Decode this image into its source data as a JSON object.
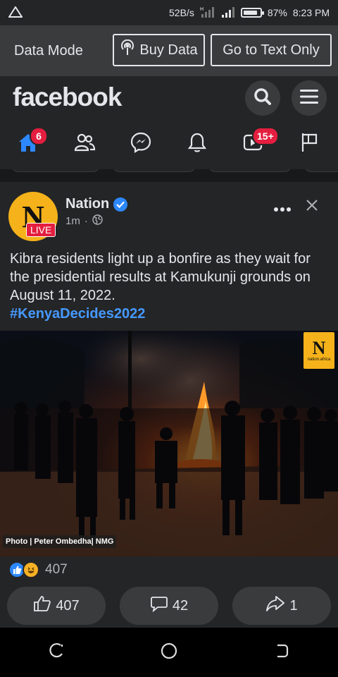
{
  "status_bar": {
    "network_speed": "52B/s",
    "battery_percent": "87%",
    "battery_level": 0.87,
    "time": "8:23 PM"
  },
  "data_mode": {
    "label": "Data Mode",
    "buy_data": "Buy Data",
    "text_only": "Go to Text Only"
  },
  "header": {
    "logo": "facebook"
  },
  "nav": {
    "home_badge": "6",
    "watch_badge": "15+"
  },
  "post": {
    "page_name": "Nation",
    "avatar_letter": "N",
    "live_label": "LIVE",
    "time_ago": "1m",
    "separator": "·",
    "text": "Kibra residents light up a bonfire as they wait for the presidential results at Kamukunji grounds on August 11, 2022.",
    "hashtag": "#KenyaDecides2022",
    "photo_credit": "Photo | Peter Ombedha| NMG",
    "photo_logo_letter": "N",
    "photo_logo_text": "nation.africa",
    "reaction_count": "407",
    "like_count": "407",
    "comment_count": "42",
    "share_count": "1"
  },
  "colors": {
    "background": "#242526",
    "accent": "#2d88ff",
    "badge": "#e41e3f",
    "nation_yellow": "#f5b21a"
  }
}
